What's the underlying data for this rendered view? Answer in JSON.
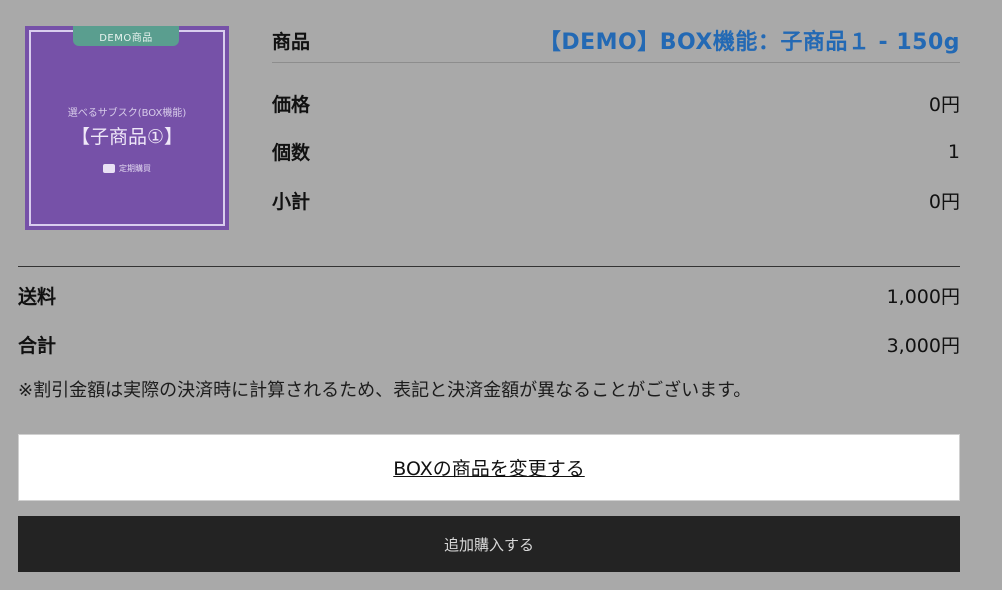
{
  "product": {
    "thumbnail": {
      "badge": "DEMO商品",
      "subtitle": "選べるサブスク(BOX機能)",
      "title": "【子商品①】",
      "logo_text": "定期購買"
    },
    "rows": {
      "product_label": "商品",
      "product_name": "【DEMO】BOX機能：子商品１ - 150g",
      "price_label": "価格",
      "price_value": "0円",
      "qty_label": "個数",
      "qty_value": "1",
      "subtotal_label": "小計",
      "subtotal_value": "0円"
    }
  },
  "summary": {
    "shipping_label": "送料",
    "shipping_value": "1,000円",
    "total_label": "合計",
    "total_value": "3,000円",
    "note": "※割引金額は実際の決済時に計算されるため、表記と決済金額が異なることがございます。"
  },
  "actions": {
    "change_label": "BOXの商品を変更する",
    "buy_label": "追加購入する"
  },
  "colors": {
    "background": "#a9a9a9",
    "thumbnail_bg": "#7651a8",
    "product_link": "#2369b4",
    "buy_button": "#232323"
  }
}
